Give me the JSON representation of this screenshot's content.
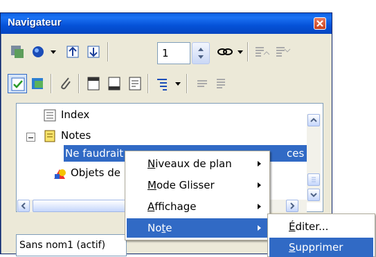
{
  "window": {
    "title": "Navigateur",
    "close_icon": "close-icon"
  },
  "toolbar": {
    "level_value": "1"
  },
  "tree": {
    "items": [
      {
        "label": "Index",
        "icon": "index-icon"
      },
      {
        "label": "Notes",
        "icon": "notes-icon"
      },
      {
        "label": "Ne faudrait",
        "icon": "",
        "label_tail": "ces in"
      },
      {
        "label": "Objets de",
        "icon": "drawing-objects-icon"
      }
    ]
  },
  "status": {
    "document": "Sans nom1 (actif)"
  },
  "context_menu": {
    "items": [
      {
        "label": "Niveaux de plan",
        "accel": "N",
        "has_submenu": true
      },
      {
        "label": "Mode Glisser",
        "accel": "M",
        "has_submenu": true
      },
      {
        "label": "Affichage",
        "accel": "A",
        "has_submenu": true
      },
      {
        "label": "Note",
        "accel": "t",
        "has_submenu": true,
        "highlighted": true
      }
    ]
  },
  "submenu": {
    "items": [
      {
        "label": "Éditer...",
        "accel": "É"
      },
      {
        "label": "Supprimer",
        "accel": "S",
        "highlighted": true
      }
    ]
  },
  "colors": {
    "selection": "#316ac5",
    "title_bar": "#0552d8",
    "window_bg": "#ece9d8"
  }
}
